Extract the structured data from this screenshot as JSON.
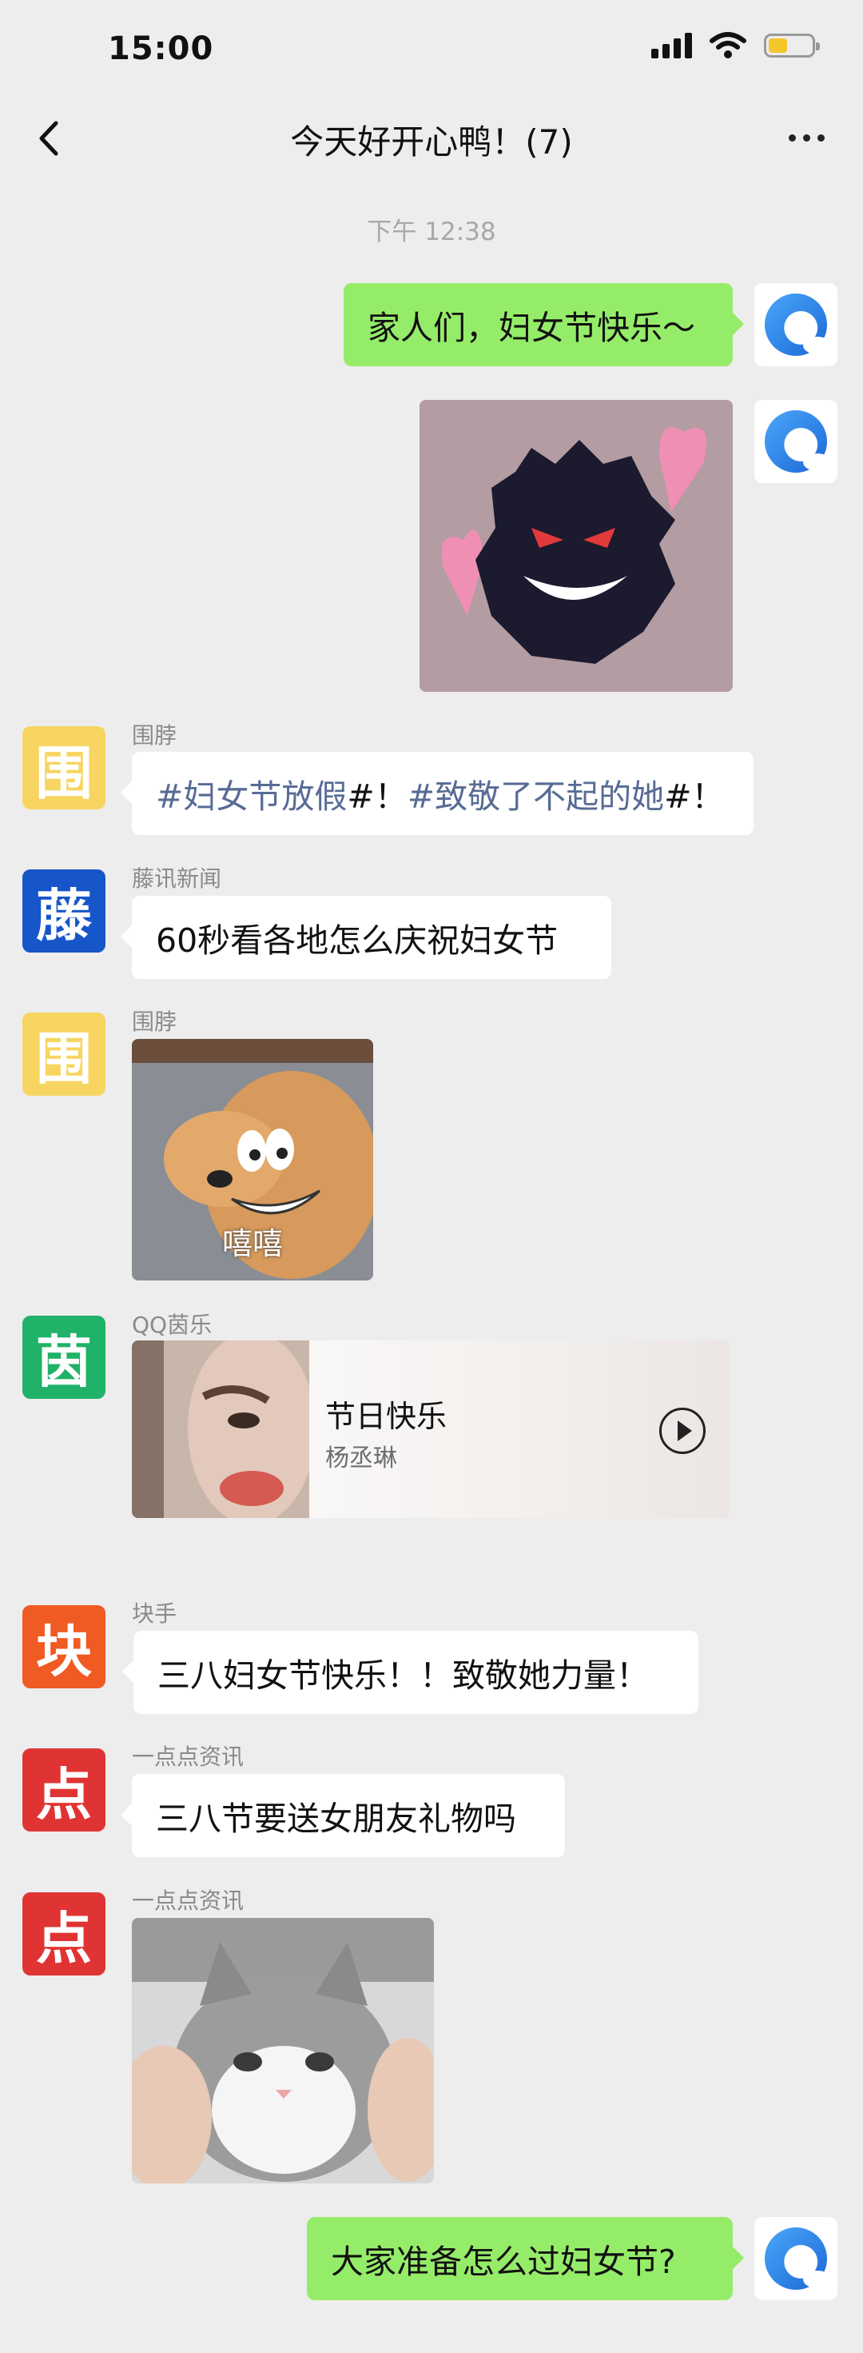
{
  "status_bar": {
    "time": "15:00",
    "battery_level": 0.45
  },
  "nav": {
    "title": "今天好开心鸭！(7)"
  },
  "chat": {
    "timestamp": "下午 12:38",
    "messages": [
      {
        "from": "self",
        "type": "text",
        "text": "家人们，妇女节快乐～"
      },
      {
        "from": "self",
        "type": "image",
        "description": "gengar-hearts sticker"
      },
      {
        "from": "围脖",
        "avatar_char": "围",
        "avatar_color": "#f7d560",
        "avatar_text_color": "#f4c02a",
        "type": "text",
        "parts": [
          "#妇女节放假",
          "#！",
          "#致敬了不起的她",
          "#！"
        ]
      },
      {
        "from": "藤讯新闻",
        "avatar_char": "藤",
        "avatar_color": "#1656c9",
        "type": "text",
        "text": "60秒看各地怎么庆祝妇女节"
      },
      {
        "from": "围脖",
        "avatar_char": "围",
        "avatar_color": "#f7d560",
        "type": "image",
        "caption": "嘻嘻"
      },
      {
        "from": "QQ茵乐",
        "avatar_char": "茵",
        "avatar_color": "#20b268",
        "type": "music",
        "song": "节日快乐",
        "artist": "杨丞琳"
      },
      {
        "from": "块手",
        "avatar_char": "块",
        "avatar_color": "#f05a23",
        "type": "text",
        "text": "三八妇女节快乐！！致敬她力量！"
      },
      {
        "from": "一点点资讯",
        "avatar_char": "点",
        "avatar_color": "#e03434",
        "type": "text",
        "text": "三八节要送女朋友礼物吗"
      },
      {
        "from": "一点点资讯",
        "avatar_char": "点",
        "avatar_color": "#e03434",
        "type": "image",
        "description": "cat photo"
      },
      {
        "from": "self",
        "type": "text",
        "text": "大家准备怎么过妇女节?"
      }
    ]
  }
}
